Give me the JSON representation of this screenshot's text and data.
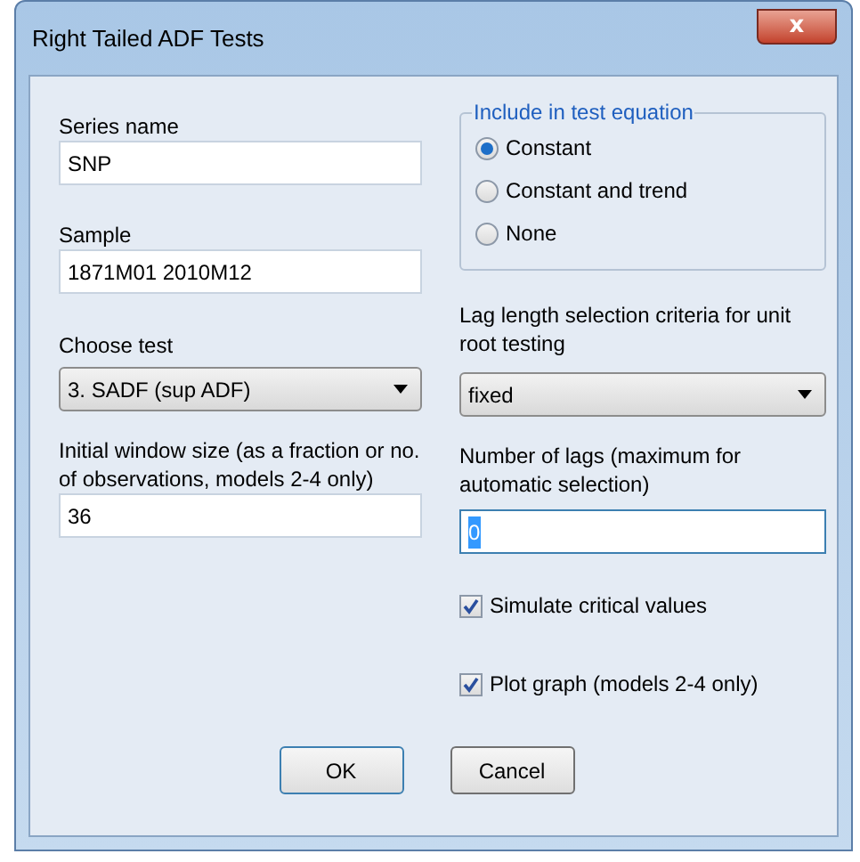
{
  "window": {
    "title": "Right Tailed ADF Tests",
    "close_label": "x"
  },
  "left": {
    "series_name": {
      "label": "Series name",
      "value": "SNP"
    },
    "sample": {
      "label": "Sample",
      "value": "1871M01 2010M12"
    },
    "choose_test": {
      "label": "Choose test",
      "value": "3. SADF (sup ADF)"
    },
    "initial_window": {
      "label": "Initial window size (as a fraction or no. of observations, models 2-4 only)",
      "value": "36"
    }
  },
  "right": {
    "include_group": {
      "title": "Include in test equation",
      "options": [
        {
          "label": "Constant",
          "selected": true
        },
        {
          "label": "Constant and trend",
          "selected": false
        },
        {
          "label": "None",
          "selected": false
        }
      ]
    },
    "lag_criteria": {
      "label": "Lag length selection criteria for unit root testing",
      "value": "fixed"
    },
    "number_of_lags": {
      "label": "Number of lags (maximum for automatic selection)",
      "value": "0",
      "text_selected": true
    },
    "checkboxes": [
      {
        "label": "Simulate critical values",
        "checked": true
      },
      {
        "label": "Plot graph (models 2-4 only)",
        "checked": true
      }
    ]
  },
  "buttons": [
    {
      "label": "OK",
      "default": true
    },
    {
      "label": "Cancel",
      "default": false
    }
  ]
}
